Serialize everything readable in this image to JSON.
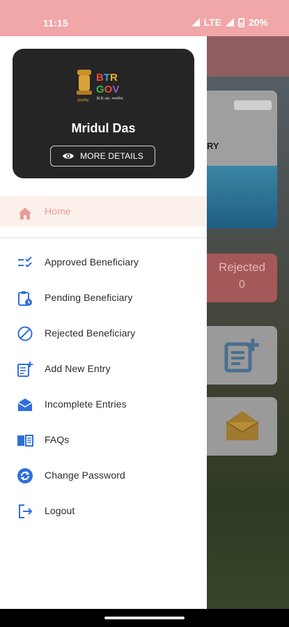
{
  "status_bar": {
    "time": "11:15",
    "network": "LTE",
    "battery": "20%"
  },
  "drawer": {
    "profile": {
      "logo_text_line1": "BTR",
      "logo_text_line2": "GOV",
      "user_name": "Mridul Das",
      "more_details_label": "MORE DETAILS"
    },
    "menu": [
      {
        "label": "Home",
        "icon": "home-icon",
        "selected": true
      },
      {
        "label": "Approved Beneficiary",
        "icon": "checklist-icon"
      },
      {
        "label": "Pending Beneficiary",
        "icon": "pending-clipboard-icon"
      },
      {
        "label": "Rejected Beneficiary",
        "icon": "block-icon"
      },
      {
        "label": "Add New Entry",
        "icon": "add-note-icon"
      },
      {
        "label": "Incomplete Entries",
        "icon": "open-mail-icon"
      },
      {
        "label": "FAQs",
        "icon": "book-icon"
      },
      {
        "label": "Change Password",
        "icon": "refresh-icon"
      },
      {
        "label": "Logout",
        "icon": "logout-icon"
      }
    ]
  },
  "background": {
    "banner_text": "RY",
    "rejected_label": "Rejected",
    "rejected_count": "0"
  },
  "colors": {
    "status_bar": "#f1a6a8",
    "accent": "#e89b9d",
    "selected_row": "#fcf1ea",
    "icon_blue": "#2f6fde",
    "card": "#252525"
  }
}
